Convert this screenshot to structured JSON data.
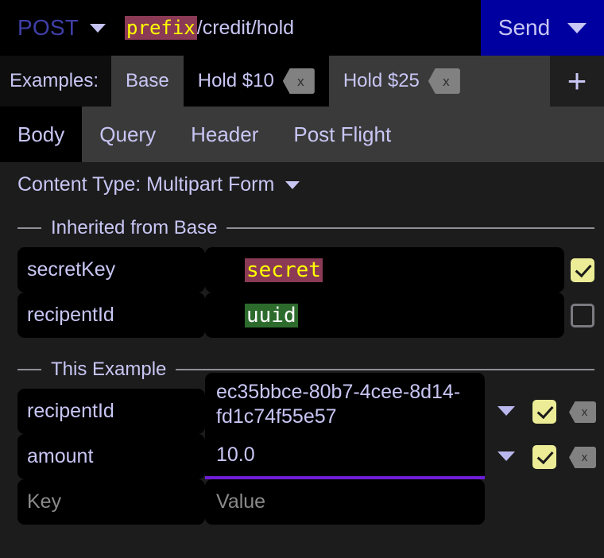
{
  "urlbar": {
    "method": "POST",
    "method_caret_icon": "chevron-down-icon",
    "url_variable": "prefix",
    "url_path": "/credit/hold",
    "send_label": "Send",
    "send_caret_icon": "chevron-down-icon",
    "send_bg_color": "#0000a0",
    "variable_chip_bg": "#8b3a55",
    "variable_chip_fg": "#ffff00"
  },
  "examples_bar": {
    "label": "Examples:",
    "tabs": [
      {
        "label": "Base",
        "active": false,
        "closable": false
      },
      {
        "label": "Hold $10",
        "active": true,
        "closable": true,
        "close_icon": "backspace-delete-icon"
      },
      {
        "label": "Hold $25",
        "active": false,
        "closable": true,
        "close_icon": "backspace-delete-icon"
      }
    ],
    "add_label": "+",
    "add_icon": "plus-icon"
  },
  "subtabs": [
    {
      "label": "Body",
      "active": true
    },
    {
      "label": "Query",
      "active": false
    },
    {
      "label": "Header",
      "active": false
    },
    {
      "label": "Post Flight",
      "active": false
    }
  ],
  "body": {
    "content_type_label": "Content Type: Multipart Form",
    "content_type_caret_icon": "chevron-down-icon",
    "sections": [
      {
        "title": "Inherited from Base",
        "rows": [
          {
            "key": "secretKey",
            "value_chip": "secret",
            "chip_style": "secret",
            "checkbox": "checked",
            "has_caret": false,
            "has_delete": false,
            "key_muted": false
          },
          {
            "key": "recipentId",
            "value_chip": "uuid",
            "chip_style": "uuid",
            "checkbox": "unchecked",
            "has_caret": false,
            "has_delete": false,
            "key_muted": false
          }
        ]
      },
      {
        "title": "This Example",
        "rows": [
          {
            "key": "recipentId",
            "value": "ec35bbce-80b7-4cee-8d14-fd1c74f55e57",
            "checkbox": "checked",
            "has_caret": true,
            "caret_icon": "chevron-down-icon",
            "has_delete": true,
            "delete_icon": "backspace-delete-icon",
            "key_muted": false,
            "tall": true
          },
          {
            "key": "amount",
            "value": "10.0",
            "checkbox": "checked",
            "has_caret": true,
            "caret_icon": "chevron-down-icon",
            "has_delete": true,
            "delete_icon": "backspace-delete-icon",
            "key_muted": false,
            "focused": true,
            "focus_color": "#6d1ed6"
          },
          {
            "key": "Key",
            "value": "Value",
            "placeholder_row": true,
            "key_muted": true
          }
        ]
      }
    ]
  }
}
